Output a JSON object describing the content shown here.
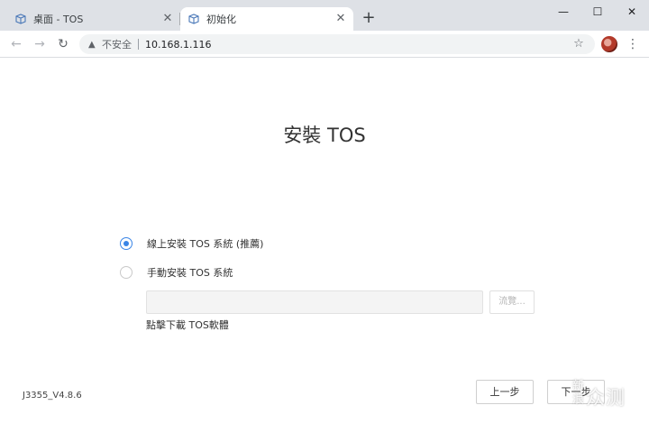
{
  "browser": {
    "tabs": [
      {
        "title": "桌面 - TOS",
        "active": false
      },
      {
        "title": "初始化",
        "active": true
      }
    ],
    "new_tab_symbol": "+",
    "close_symbol": "✕",
    "window_controls": {
      "minimize": "—",
      "maximize": "☐",
      "close": "✕"
    },
    "nav": {
      "back": "←",
      "forward": "→",
      "reload": "↻"
    },
    "address": {
      "security_label": "不安全",
      "url": "10.168.1.116",
      "warning_icon": "warning-icon",
      "star_icon": "star-icon"
    },
    "menu_symbol": "⋮"
  },
  "page": {
    "title": "安裝 TOS",
    "options": [
      {
        "label": "線上安裝 TOS 系統 (推薦)",
        "selected": true
      },
      {
        "label": "手動安裝 TOS 系統",
        "selected": false
      }
    ],
    "file_input": {
      "value": "",
      "placeholder": ""
    },
    "browse_label": "流覽...",
    "download_link": "點擊下載 TOS軟體",
    "version": "J3355_V4.8.6",
    "buttons": {
      "prev": "上一步",
      "next": "下一步"
    }
  },
  "watermark": {
    "line1": "新浪",
    "line2": "众测"
  },
  "colors": {
    "accent": "#3a85e6",
    "tabstrip": "#dee1e6",
    "omnibox": "#f1f3f4"
  }
}
